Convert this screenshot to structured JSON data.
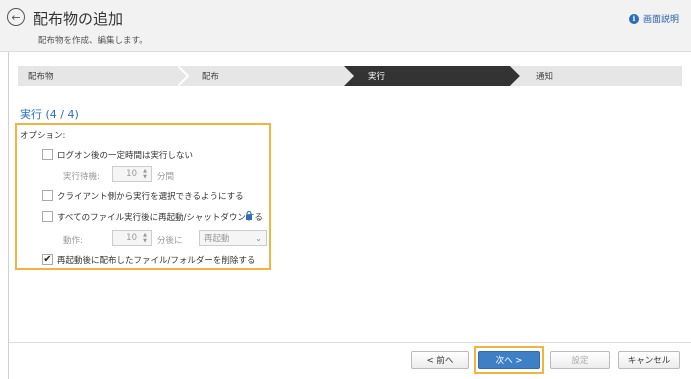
{
  "header": {
    "title": "配布物の追加",
    "subtitle": "配布物を作成、編集します。",
    "help_label": "画面説明"
  },
  "steps": [
    {
      "label": "配布物",
      "active": false
    },
    {
      "label": "配布",
      "active": false
    },
    {
      "label": "実行",
      "active": true
    },
    {
      "label": "通知",
      "active": false
    }
  ],
  "section": {
    "title": "実行 (4 / 4)",
    "options_label": "オプション:"
  },
  "options": {
    "logon_wait": {
      "label": "ログオン後の一定時間は実行しない",
      "checked": false
    },
    "wait_label": "実行待機:",
    "wait_value": "10",
    "wait_unit": "分間",
    "client_choose": {
      "label": "クライアント側から実行を選択できるようにする",
      "checked": false
    },
    "restart_after": {
      "label": "すべてのファイル実行後に再起動/シャットダウンする",
      "checked": false
    },
    "action_label": "動作:",
    "action_value": "10",
    "action_unit": "分後に",
    "action_select": "再起動",
    "delete_after_restart": {
      "label": "再起動後に配布したファイル/フォルダーを削除する",
      "checked": true,
      "mark": "✔"
    }
  },
  "buttons": {
    "prev": "< 前へ",
    "next": "次へ >",
    "setting": "設定",
    "cancel": "キャンセル"
  },
  "colors": {
    "accent": "#2a6fb8",
    "highlight": "#f0b441",
    "active_step": "#333333"
  }
}
